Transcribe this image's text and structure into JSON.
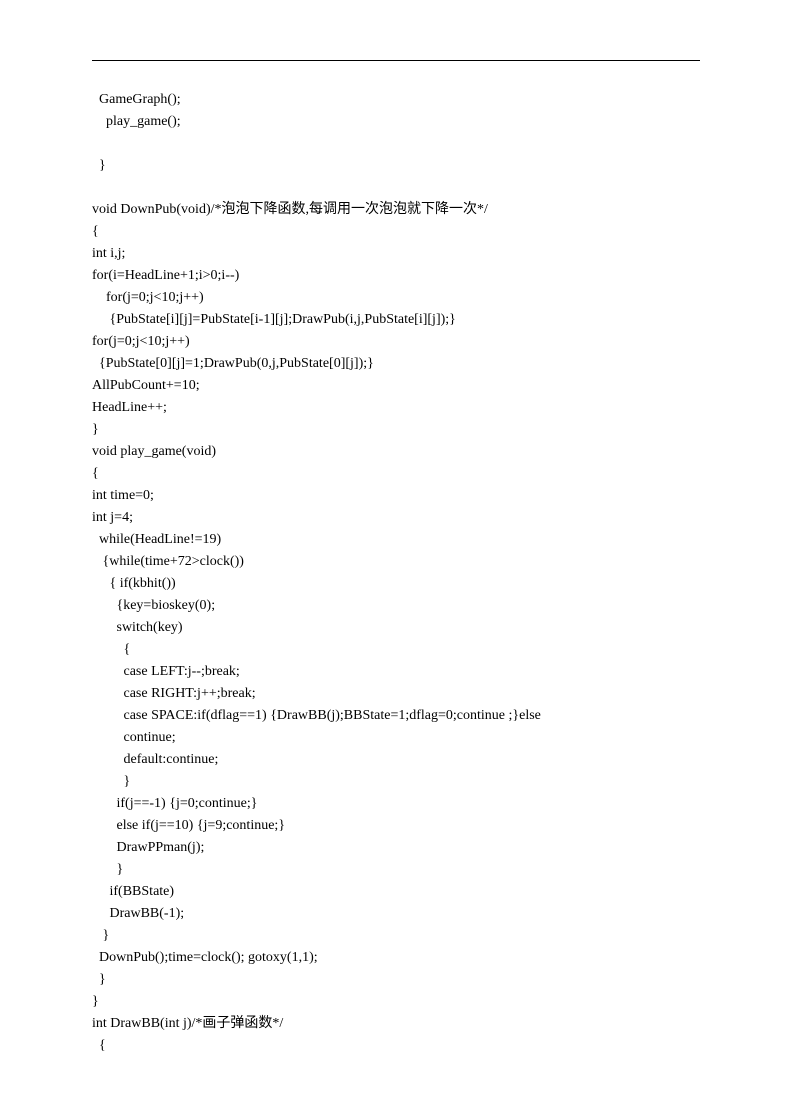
{
  "lines": [
    "  GameGraph();",
    "    play_game();",
    "",
    "  }",
    "",
    "void DownPub(void)/*泡泡下降函数,每调用一次泡泡就下降一次*/",
    "{",
    "int i,j;",
    "for(i=HeadLine+1;i>0;i--)",
    "    for(j=0;j<10;j++)",
    "     {PubState[i][j]=PubState[i-1][j];DrawPub(i,j,PubState[i][j]);}",
    "for(j=0;j<10;j++)",
    "  {PubState[0][j]=1;DrawPub(0,j,PubState[0][j]);}",
    "AllPubCount+=10;",
    "HeadLine++;",
    "}",
    "void play_game(void)",
    "{",
    "int time=0;",
    "int j=4;",
    "  while(HeadLine!=19)",
    "   {while(time+72>clock())",
    "     { if(kbhit())",
    "       {key=bioskey(0);",
    "       switch(key)",
    "         {",
    "         case LEFT:j--;break;",
    "         case RIGHT:j++;break;",
    "         case SPACE:if(dflag==1) {DrawBB(j);BBState=1;dflag=0;continue ;}else",
    "         continue;",
    "         default:continue;",
    "         }",
    "       if(j==-1) {j=0;continue;}",
    "       else if(j==10) {j=9;continue;}",
    "       DrawPPman(j);",
    "       }",
    "     if(BBState)",
    "     DrawBB(-1);",
    "   }",
    "  DownPub();time=clock(); gotoxy(1,1);",
    "  }",
    "}",
    "int DrawBB(int j)/*画子弹函数*/",
    "  {"
  ]
}
